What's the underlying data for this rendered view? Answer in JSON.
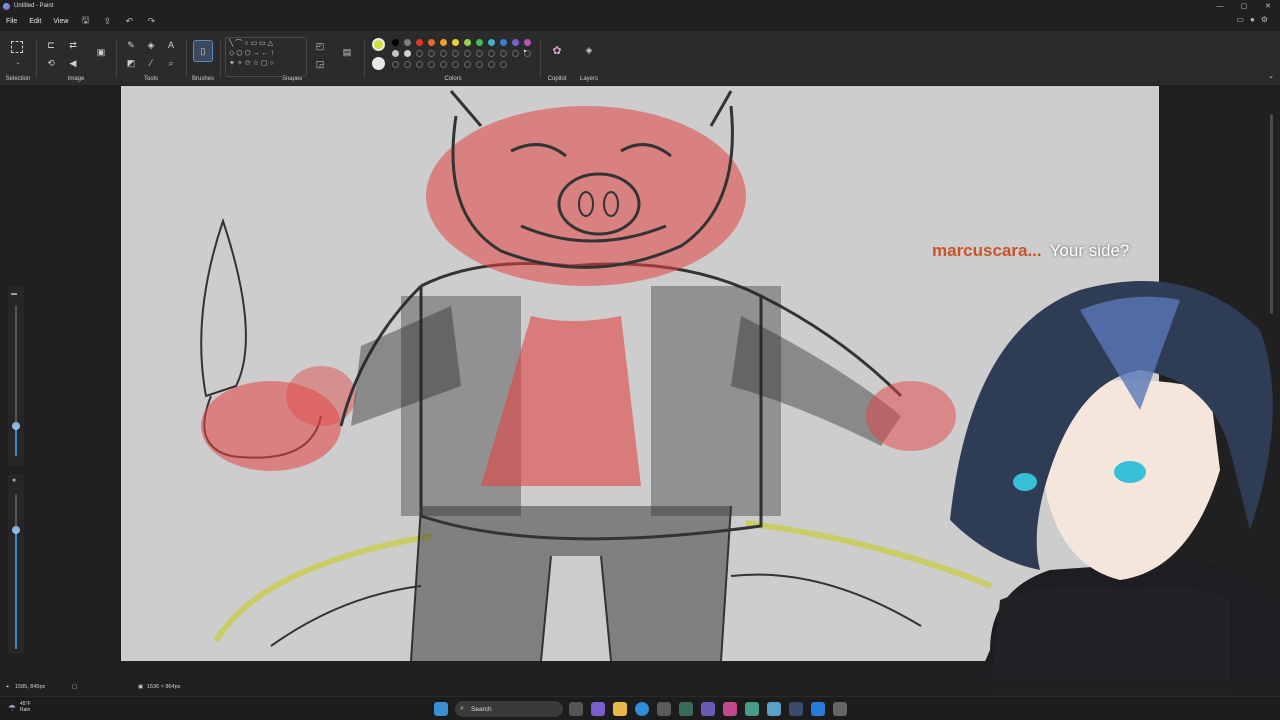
{
  "window": {
    "title": "Untitled - Paint",
    "controls": [
      "—",
      "▢",
      "✕"
    ]
  },
  "menu": {
    "file": "File",
    "edit": "Edit",
    "view": "View"
  },
  "ribbon": {
    "groups": {
      "selection": "Selection",
      "image": "Image",
      "tools": "Tools",
      "brushes": "Brushes",
      "shapes": "Shapes",
      "colors": "Colors",
      "copilot": "Copilot",
      "layers": "Layers"
    },
    "shapes_glyphs": "╲⌒○▭▭△\n◇⬠⬡→←↑\n✦✧✩☆▢○",
    "colors_row1": [
      "#000000",
      "#7f7f7f",
      "#e6352b",
      "#e86a2b",
      "#f0a030",
      "#e8d435",
      "#9bd14a",
      "#3fbf5a",
      "#3fb6c6",
      "#3c7fd8",
      "#7b5dd0",
      "#c04fc0"
    ],
    "colors_row2_filled": [
      "#c3c3c3",
      "#d0d0d0"
    ],
    "active_color_1": "#d4e03a",
    "active_color_2": "#e8e8e8"
  },
  "status": {
    "cursor_pos": "1585, 845px",
    "canvas_size": "1536 × 864px"
  },
  "taskbar": {
    "weather_temp": "45°F",
    "weather_desc": "Rain",
    "search_placeholder": "Search"
  },
  "stream_overlay": {
    "chat_user": "marcuscara...",
    "chat_message": "Your side?"
  }
}
